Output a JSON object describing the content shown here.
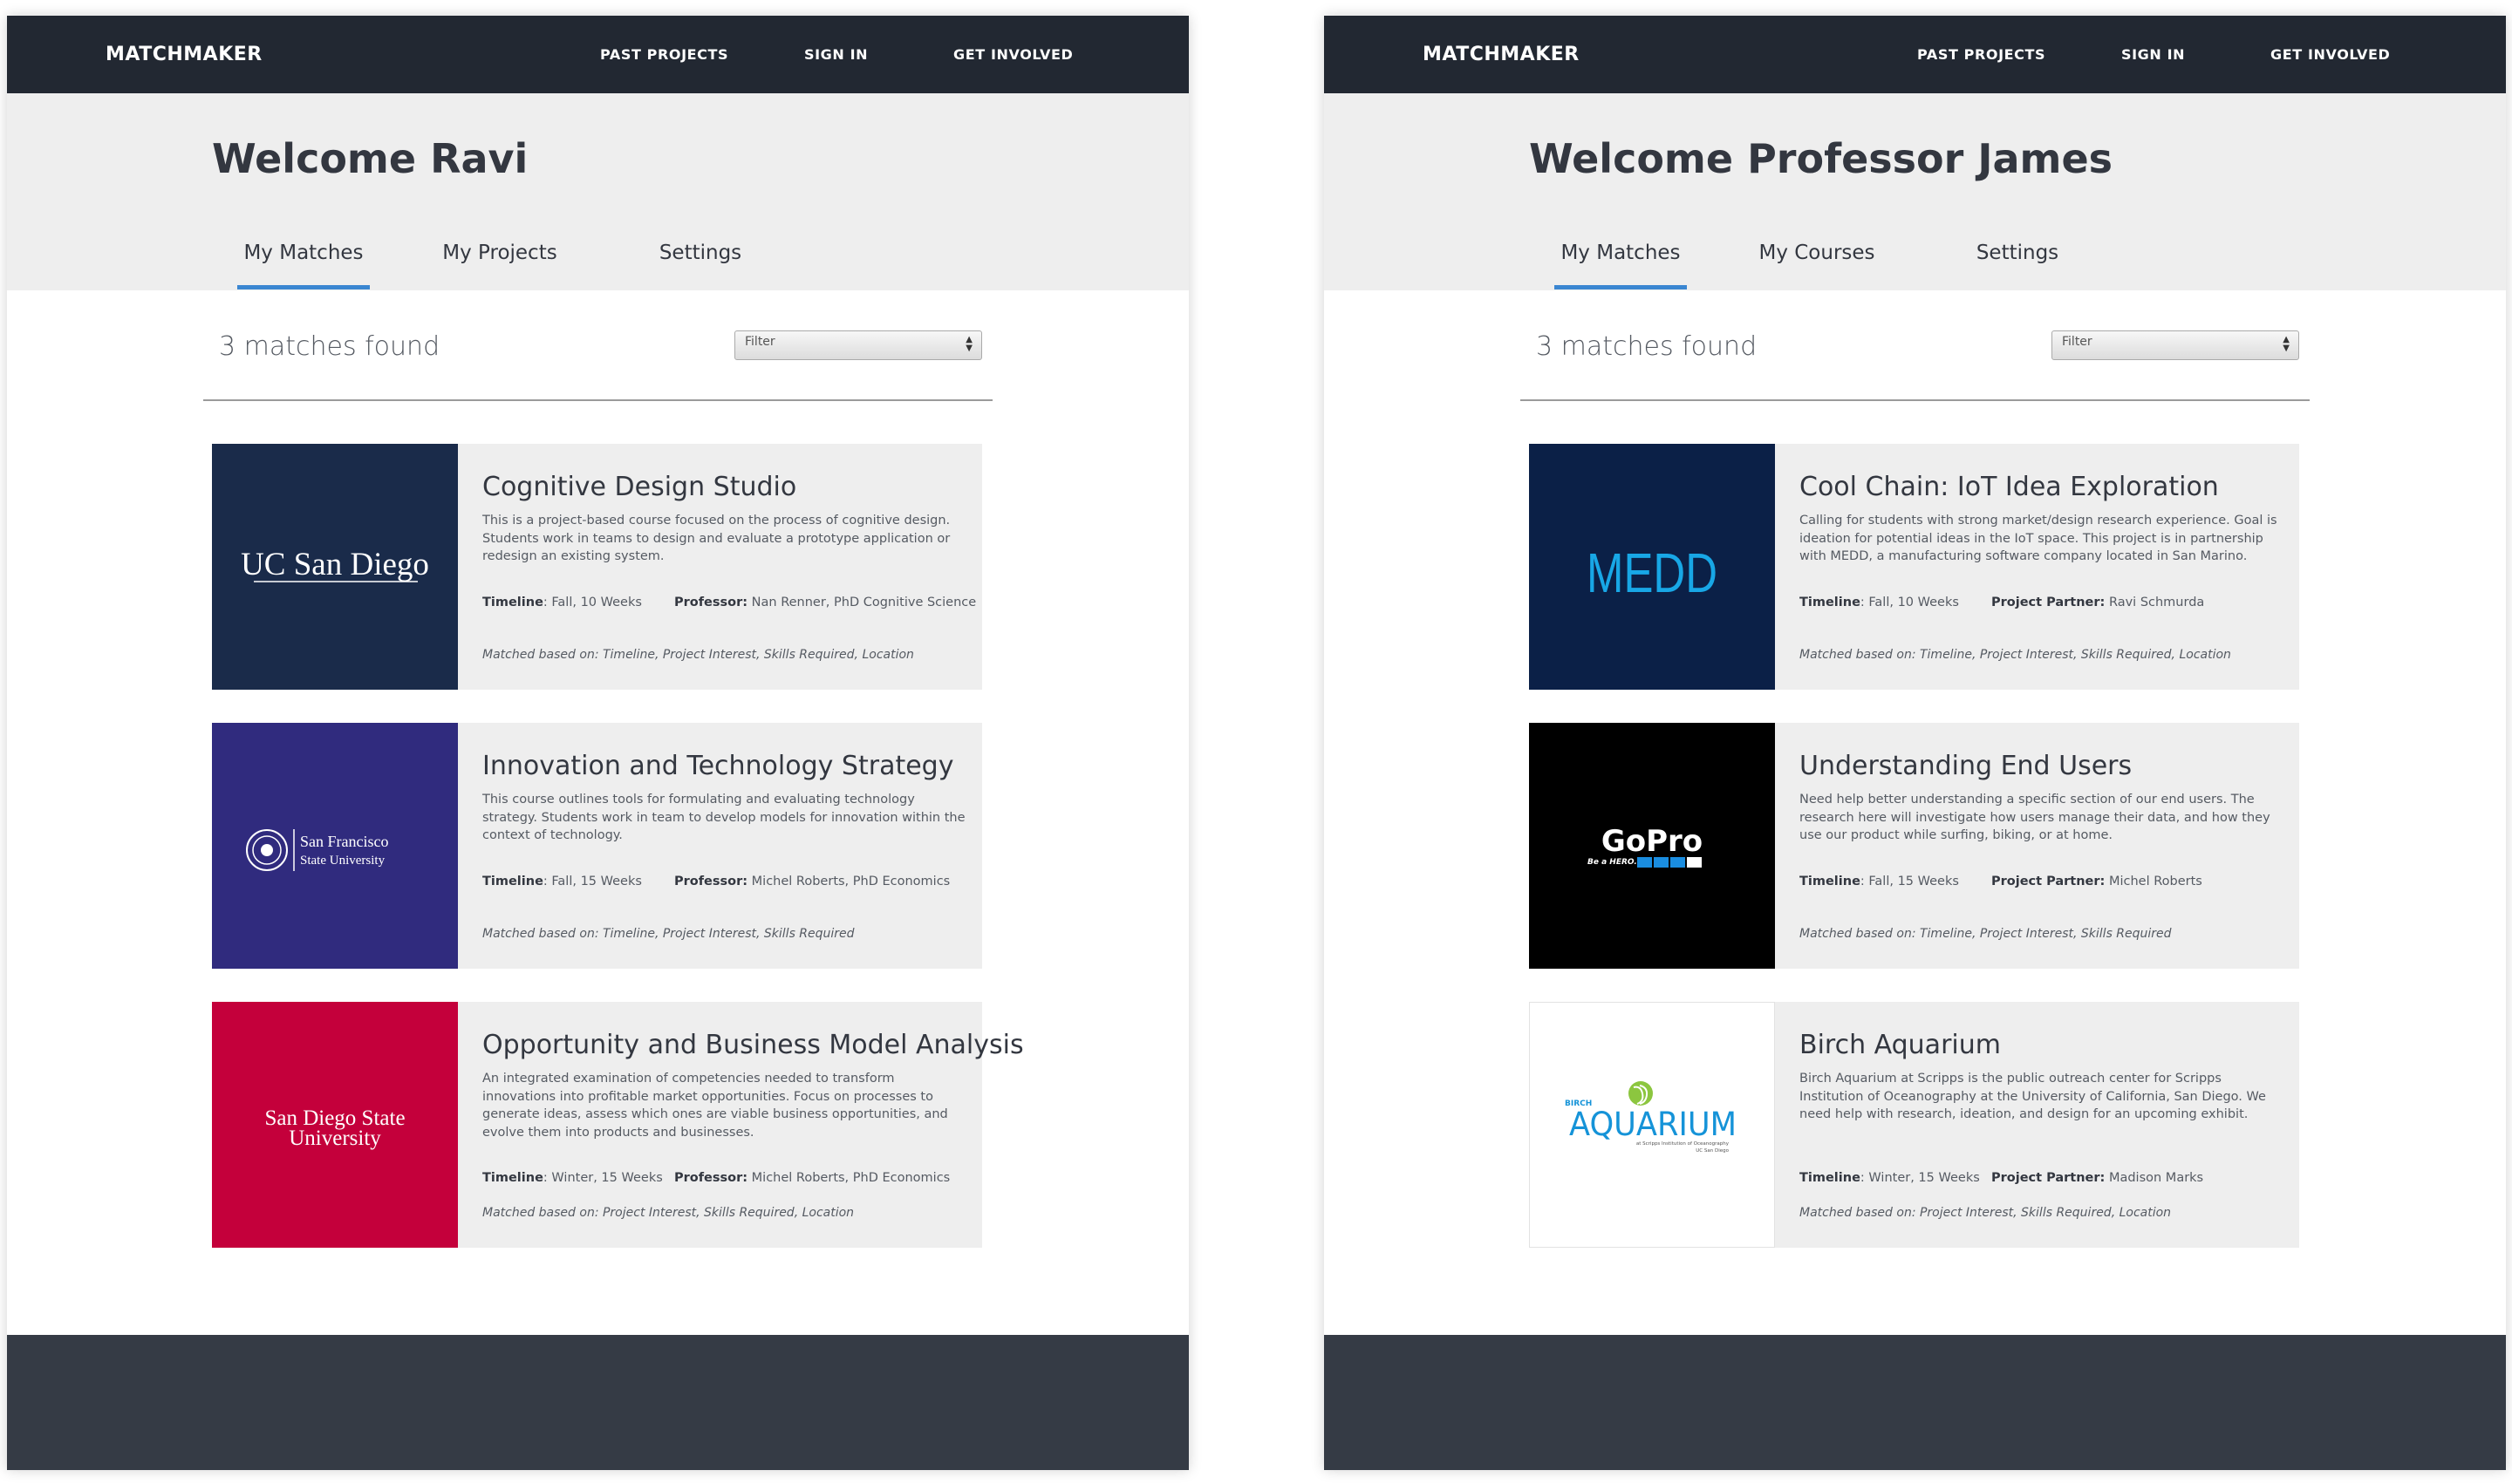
{
  "colors": {
    "navbar": "#222832",
    "accent": "#3a86d1",
    "footer": "#353b45",
    "card_bg": "#eeeeee",
    "ucsd_bg": "#1a2b4a",
    "sfsu_bg": "#302b7e",
    "sdsu_bg": "#c4003b",
    "medd_bg": "#0b2047",
    "medd_text": "#18a7e6",
    "gopro_bg": "#000000",
    "aquarium_blue": "#1593d8",
    "aquarium_green": "#8cc63f"
  },
  "nav": {
    "brand": "MATCHMAKER",
    "past_projects": "PAST PROJECTS",
    "sign_in": "SIGN IN",
    "get_involved": "GET INVOLVED"
  },
  "left": {
    "welcome": "Welcome Ravi",
    "tabs": [
      "My Matches",
      "My Projects",
      "Settings"
    ],
    "matches_count": "3 matches found",
    "filter_placeholder": "Filter",
    "cards": [
      {
        "logo": "UC San Diego",
        "title": "Cognitive Design Studio",
        "description": "This is a project-based course focused on the process of cognitive design. Students work in teams to design and evaluate a prototype application or redesign an existing system.",
        "timeline_label": "Timeline",
        "timeline": ": Fall, 10 Weeks",
        "person_label": "Professor:",
        "person": " Nan Renner, PhD Cognitive Science",
        "matched": "Matched based on: Timeline, Project Interest, Skills Required, Location"
      },
      {
        "logo_line1": "San Francisco",
        "logo_line2": "State University",
        "title": "Innovation and Technology Strategy",
        "description": "This course outlines tools for formulating and evaluating technology strategy. Students work in team to develop models for innovation within the context of technology.",
        "timeline_label": "Timeline",
        "timeline": ": Fall, 15 Weeks",
        "person_label": "Professor:",
        "person": " Michel Roberts, PhD Economics",
        "matched": "Matched based on: Timeline, Project Interest, Skills Required"
      },
      {
        "logo_line1": "San Diego State",
        "logo_line2": "University",
        "title": "Opportunity and Business Model Analysis",
        "description": "An integrated examination of competencies needed to transform innovations into profitable market opportunities. Focus on processes to generate ideas, assess which ones are viable business opportunities, and evolve them into products and businesses.",
        "timeline_label": "Timeline",
        "timeline": ": Winter, 15 Weeks",
        "person_label": "Professor:",
        "person": " Michel Roberts, PhD Economics",
        "matched": "Matched based on: Project Interest, Skills Required, Location"
      }
    ]
  },
  "right": {
    "welcome": "Welcome Professor James",
    "tabs": [
      "My Matches",
      "My Courses",
      "Settings"
    ],
    "matches_count": "3 matches found",
    "filter_placeholder": "Filter",
    "cards": [
      {
        "logo": "MEDD",
        "title": "Cool Chain: IoT Idea Exploration",
        "description": "Calling for students with strong market/design research experience. Goal is ideation for potential ideas in the IoT space. This project is in partnership with MEDD, a manufacturing software company located in San Marino.",
        "timeline_label": "Timeline",
        "timeline": ": Fall, 10 Weeks",
        "person_label": "Project Partner:",
        "person": " Ravi Schmurda",
        "matched": "Matched based on: Timeline, Project Interest, Skills Required, Location"
      },
      {
        "logo": "GoPro",
        "logo_tag": "Be a HERO.",
        "title": "Understanding End Users",
        "description": "Need help better understanding a specific section of our end users. The research here will investigate how users manage their data, and how they use our product while surfing, biking, or at home.",
        "timeline_label": "Timeline",
        "timeline": ": Fall, 15 Weeks",
        "person_label": "Project Partner:",
        "person": " Michel Roberts",
        "matched": "Matched based on: Timeline, Project Interest, Skills Required"
      },
      {
        "logo_small": "BIRCH",
        "logo": "AQUARIUM",
        "logo_sub1": "at Scripps Institution of Oceanography",
        "logo_sub2": "UC San Diego",
        "title": "Birch Aquarium",
        "description": "Birch Aquarium at Scripps is the public outreach center for Scripps Institution of Oceanography at the University of California, San Diego. We need help with research, ideation, and design for an upcoming exhibit.",
        "timeline_label": "Timeline",
        "timeline": ": Winter, 15 Weeks",
        "person_label": "Project Partner:",
        "person": " Madison Marks",
        "matched": "Matched based on: Project Interest, Skills Required, Location"
      }
    ]
  }
}
